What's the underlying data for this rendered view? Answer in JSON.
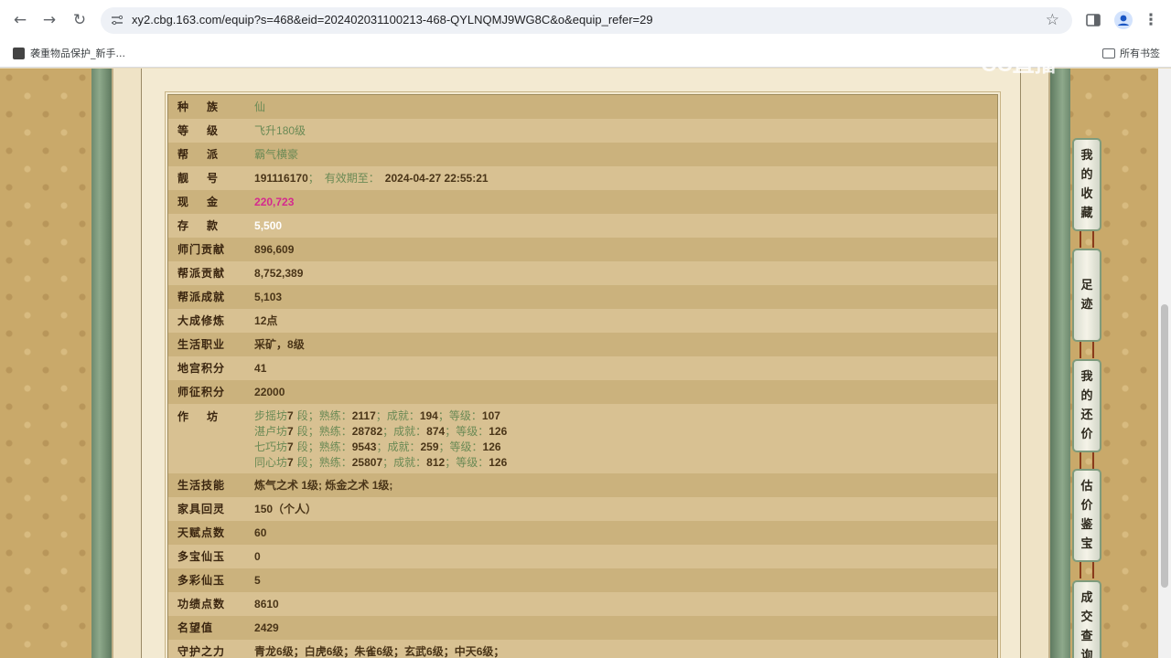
{
  "browser": {
    "url": "xy2.cbg.163.com/equip?s=468&eid=202402031100213-468-QYLNQMJ9WG8C&o&equip_refer=29",
    "bookmark_label": "袭重物品保护_新手...",
    "all_bookmarks_label": "所有书签"
  },
  "watermark": "CC直播",
  "rows": [
    {
      "label": "种族",
      "value": "仙",
      "style": "green"
    },
    {
      "label": "等级",
      "value": "飞升180级",
      "style": "green"
    },
    {
      "label": "帮派",
      "value": "霸气横豪",
      "style": "green"
    },
    {
      "label": "靓号",
      "value": "191116170",
      "note_sep": "；",
      "note_label": "有效期至：",
      "note_value": "2024-04-27 22:55:21"
    },
    {
      "label": "现金",
      "value": "220,723",
      "style": "pink"
    },
    {
      "label": "存款",
      "value": "5,500",
      "style": "white"
    },
    {
      "label": "师门贡献",
      "value": "896,609"
    },
    {
      "label": "帮派贡献",
      "value": "8,752,389"
    },
    {
      "label": "帮派成就",
      "value": "5,103"
    },
    {
      "label": "大成修炼",
      "value": "12点"
    },
    {
      "label": "生活职业",
      "value": "采矿，8级"
    },
    {
      "label": "地宫积分",
      "value": "41"
    },
    {
      "label": "师征积分",
      "value": "22000"
    }
  ],
  "workshop": {
    "label": "作坊",
    "seg": "段；",
    "exp_label": "熟练：",
    "ach_label": "成就：",
    "lvl_label": "等级：",
    "items": [
      {
        "name": "步摇坊",
        "stage": "7",
        "exp": "2117",
        "ach": "194",
        "lvl": "107"
      },
      {
        "name": "湛卢坊",
        "stage": "7",
        "exp": "28782",
        "ach": "874",
        "lvl": "126"
      },
      {
        "name": "七巧坊",
        "stage": "7",
        "exp": "9543",
        "ach": "259",
        "lvl": "126"
      },
      {
        "name": "同心坊",
        "stage": "7",
        "exp": "25807",
        "ach": "812",
        "lvl": "126"
      }
    ]
  },
  "rows2": [
    {
      "label": "生活技能",
      "value": "炼气之术 1级; 烁金之术 1级;"
    },
    {
      "label": "家具回灵",
      "value": "150（个人）"
    },
    {
      "label": "天赋点数",
      "value": "60"
    },
    {
      "label": "多宝仙玉",
      "value": "0"
    },
    {
      "label": "多彩仙玉",
      "value": "5"
    },
    {
      "label": "功绩点数",
      "value": "8610"
    },
    {
      "label": "名望值",
      "value": "2429"
    },
    {
      "label": "守护之力",
      "value": "青龙6级；白虎6级；朱雀6级；玄武6级；中天6级；"
    }
  ],
  "side_tabs": [
    {
      "chars": [
        "我",
        "的",
        "收",
        "藏"
      ]
    },
    {
      "chars": [
        "足",
        "迹"
      ]
    },
    {
      "chars": [
        "我",
        "的",
        "还",
        "价"
      ]
    },
    {
      "chars": [
        "估",
        "价",
        "鉴",
        "宝"
      ]
    },
    {
      "chars": [
        "成",
        "交",
        "查",
        "询"
      ]
    }
  ]
}
